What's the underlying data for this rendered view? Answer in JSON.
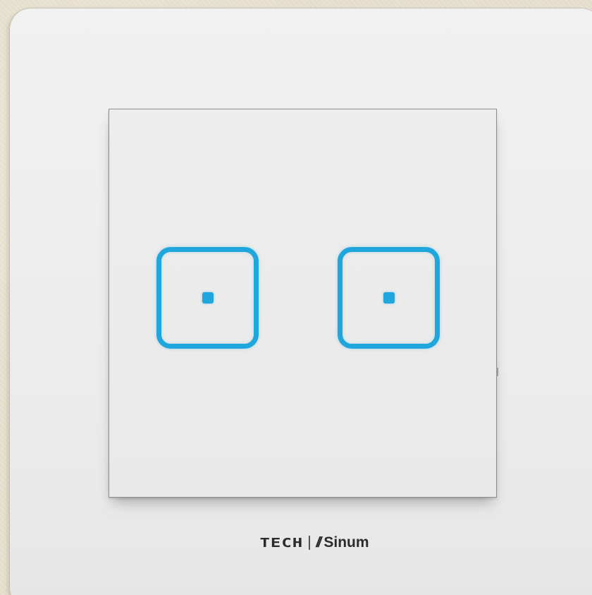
{
  "device": {
    "brand_primary": "TECH",
    "brand_mark": "//",
    "brand_secondary": "Sinum",
    "accent_color": "#1fa6dc",
    "buttons": [
      {
        "name": "left",
        "led": "on"
      },
      {
        "name": "right",
        "led": "on"
      }
    ]
  }
}
